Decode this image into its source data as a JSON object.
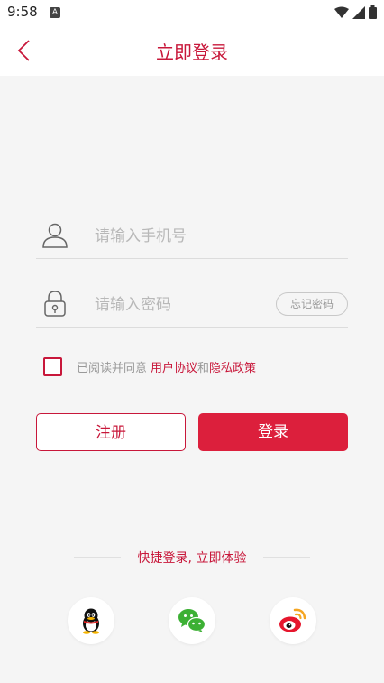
{
  "status_bar": {
    "time": "9:58",
    "notification_icon": "a-icon"
  },
  "header": {
    "title": "立即登录",
    "back_icon": "chevron-left-icon"
  },
  "form": {
    "phone_placeholder": "请输入手机号",
    "password_placeholder": "请输入密码",
    "forgot_label": "忘记密码"
  },
  "agreement": {
    "prefix": "已阅读并同意",
    "user_agreement": "用户协议",
    "and": "和",
    "privacy_policy": "隐私政策"
  },
  "buttons": {
    "register": "注册",
    "login": "登录"
  },
  "quick_login": {
    "label": "快捷登录, 立即体验",
    "providers": [
      "qq-icon",
      "wechat-icon",
      "weibo-icon"
    ]
  },
  "colors": {
    "accent": "#dc1f3c",
    "title": "#c8173a",
    "background": "#f5f5f5"
  }
}
